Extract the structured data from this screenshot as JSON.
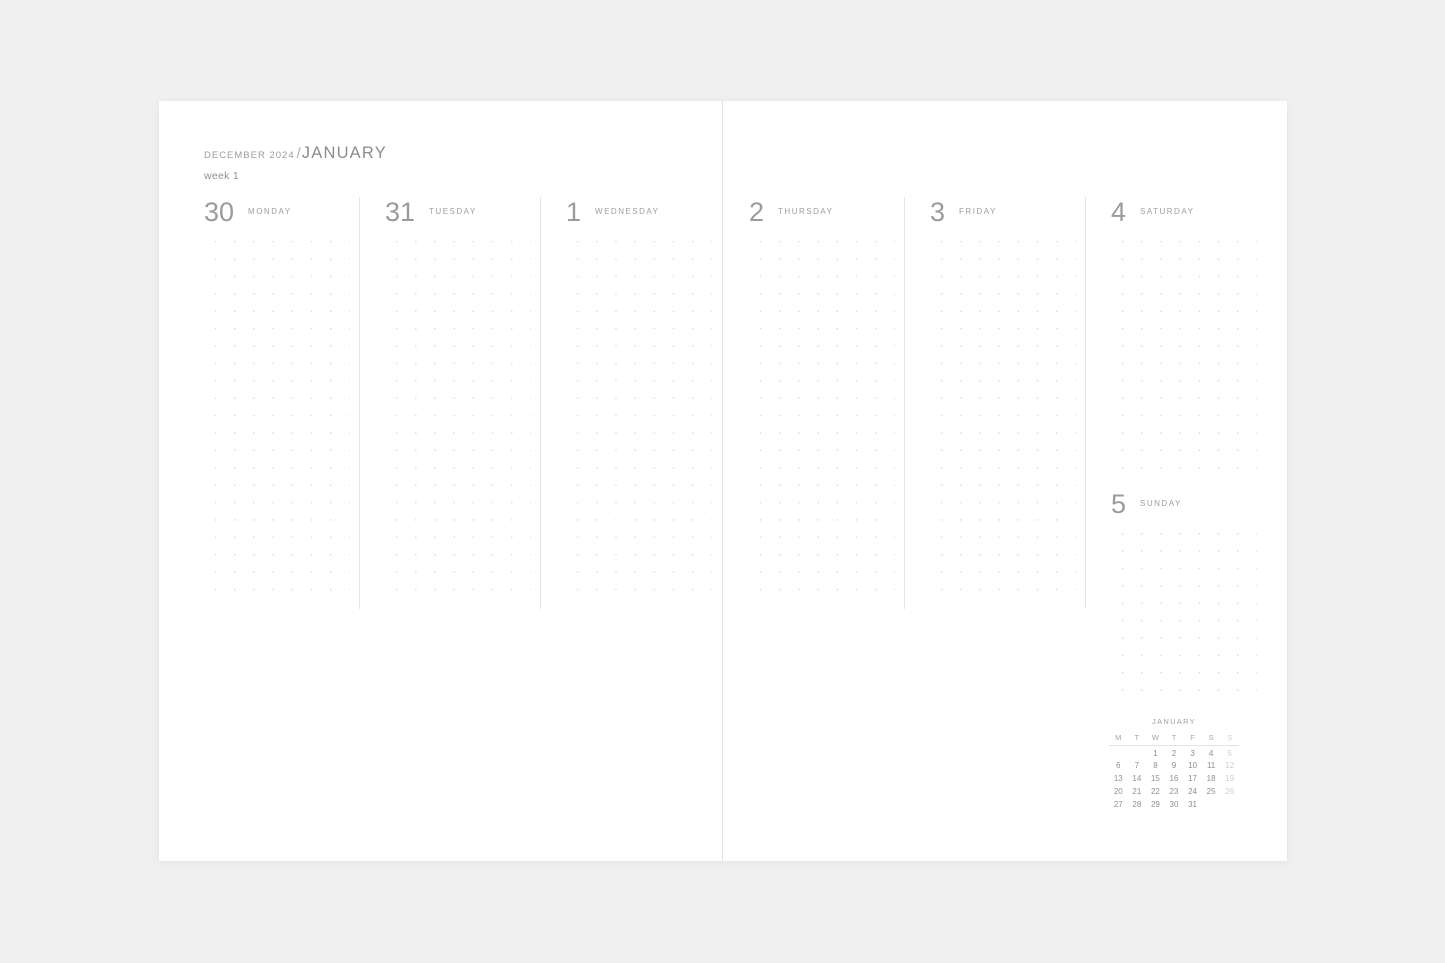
{
  "page": {
    "background_color": "#f0f0f0",
    "paper_color": "#ffffff"
  },
  "header": {
    "previous_month": "DECEMBER 2024",
    "separator": "/",
    "month": "JANUARY",
    "week": "week 1"
  },
  "days": [
    {
      "number": "30",
      "name": "MONDAY",
      "grid_rows": 21
    },
    {
      "number": "31",
      "name": "TUESDAY",
      "grid_rows": 21
    },
    {
      "number": "1",
      "name": "WEDNESDAY",
      "grid_rows": 21
    },
    {
      "number": "2",
      "name": "THURSDAY",
      "grid_rows": 21
    },
    {
      "number": "3",
      "name": "FRIDAY",
      "grid_rows": 21
    },
    {
      "number": "4",
      "name": "SATURDAY",
      "grid_rows": 14
    },
    {
      "number": "5",
      "name": "SUNDAY",
      "grid_rows": 10
    }
  ],
  "mini_calendar": {
    "title": "JANUARY",
    "weekday_headers": [
      "M",
      "T",
      "W",
      "T",
      "F",
      "S",
      "S"
    ],
    "weeks": [
      [
        "",
        "",
        "1",
        "2",
        "3",
        "4",
        "5"
      ],
      [
        "6",
        "7",
        "8",
        "9",
        "10",
        "11",
        "12"
      ],
      [
        "13",
        "14",
        "15",
        "16",
        "17",
        "18",
        "19"
      ],
      [
        "20",
        "21",
        "22",
        "23",
        "24",
        "25",
        "26"
      ],
      [
        "27",
        "28",
        "29",
        "30",
        "31",
        "",
        ""
      ]
    ],
    "sunday_column_index": 6,
    "colors": {
      "weekday": "#8f8f8f",
      "sunday": "#cfcfcf",
      "rule": "#e3e3e3"
    }
  },
  "colors": {
    "day_number": "#9b9b9b",
    "day_name": "#9e9e9e",
    "dot_grid": "#dedede",
    "divider": "#e6e6e6",
    "spine": "#e2e2e2"
  }
}
